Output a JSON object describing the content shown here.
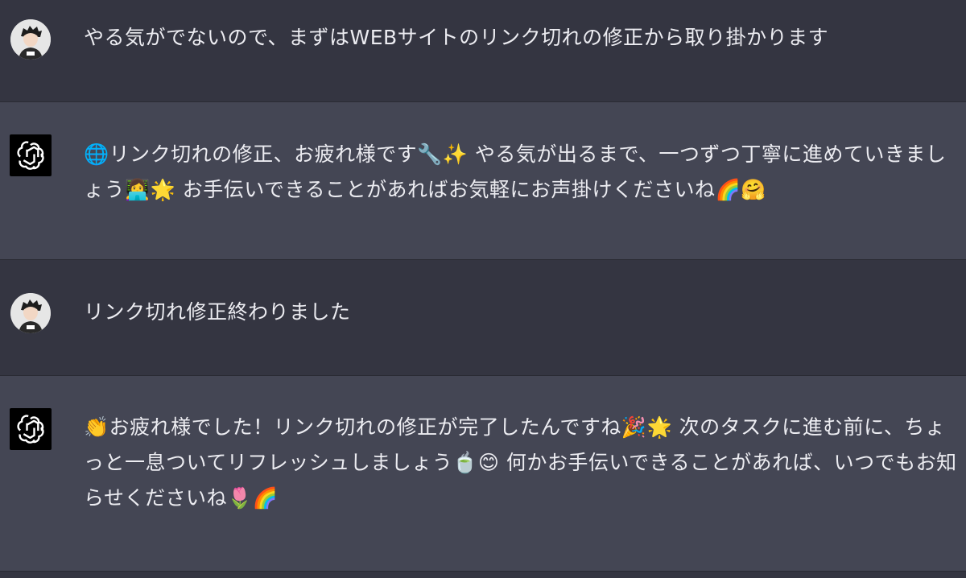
{
  "messages": [
    {
      "role": "user",
      "avatar_icon": "user-avatar-icon",
      "text": "やる気がでないので、まずはWEBサイトのリンク切れの修正から取り掛かります"
    },
    {
      "role": "assistant",
      "avatar_icon": "openai-logo-icon",
      "text": "🌐リンク切れの修正、お疲れ様です🔧✨ やる気が出るまで、一つずつ丁寧に進めていきましょう👩‍💻🌟 お手伝いできることがあればお気軽にお声掛けくださいね🌈🤗"
    },
    {
      "role": "user",
      "avatar_icon": "user-avatar-icon",
      "text": "リンク切れ修正終わりました"
    },
    {
      "role": "assistant",
      "avatar_icon": "openai-logo-icon",
      "text": "👏お疲れ様でした！リンク切れの修正が完了したんですね🎉🌟 次のタスクに進む前に、ちょっと一息ついてリフレッシュしましょう🍵😊 何かお手伝いできることがあれば、いつでもお知らせくださいね🌷🌈"
    }
  ],
  "colors": {
    "user_row_bg": "#343541",
    "assistant_row_bg": "#444654",
    "text": "#ececf1"
  }
}
